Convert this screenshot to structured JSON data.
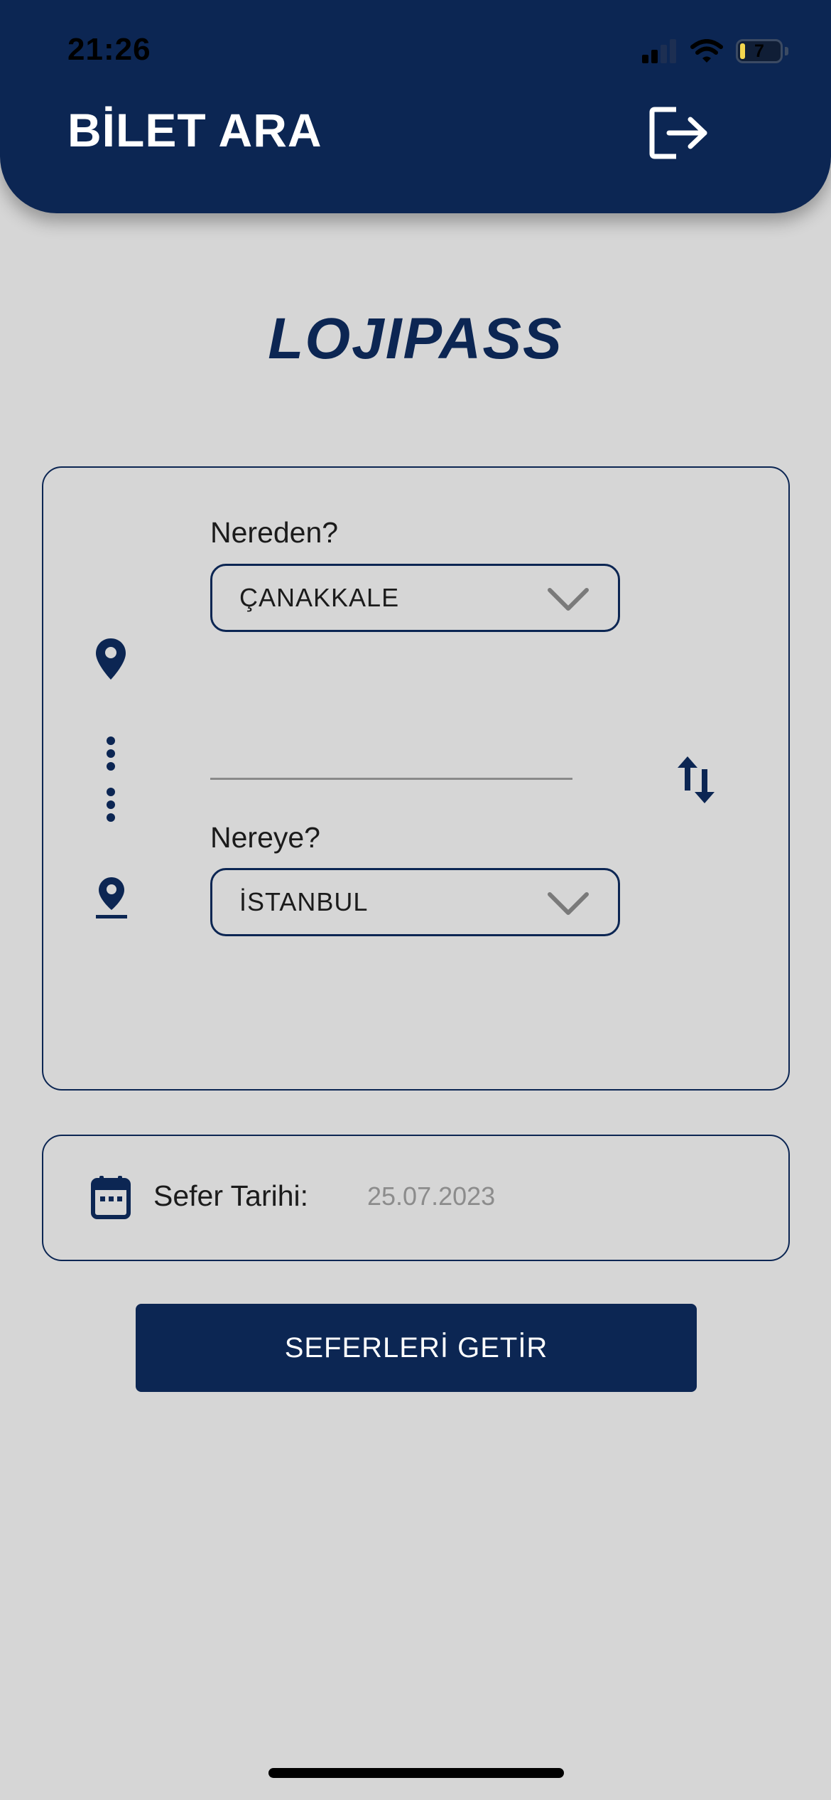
{
  "status_bar": {
    "time": "21:26",
    "battery_level": "7"
  },
  "header": {
    "title": "BİLET ARA",
    "logout_icon": "logout-icon"
  },
  "brand": {
    "name": "LOJIPASS"
  },
  "route": {
    "from_label": "Nereden?",
    "from_value": "ÇANAKKALE",
    "to_label": "Nereye?",
    "to_value": "İSTANBUL",
    "icons": [
      "map-pin-icon",
      "dotted-route-icon",
      "map-pin-destination-icon",
      "swap-icon",
      "chevron-down-icon"
    ]
  },
  "date": {
    "label": "Sefer Tarihi:",
    "value": "25.07.2023",
    "icon": "calendar-icon"
  },
  "actions": {
    "submit_label": "SEFERLERİ GETİR"
  },
  "colors": {
    "primary": "#0c2653",
    "background": "#d6d6d6",
    "text": "#1b1b1b",
    "placeholder": "#8c8c8c",
    "battery_fill": "#f3d64e"
  }
}
